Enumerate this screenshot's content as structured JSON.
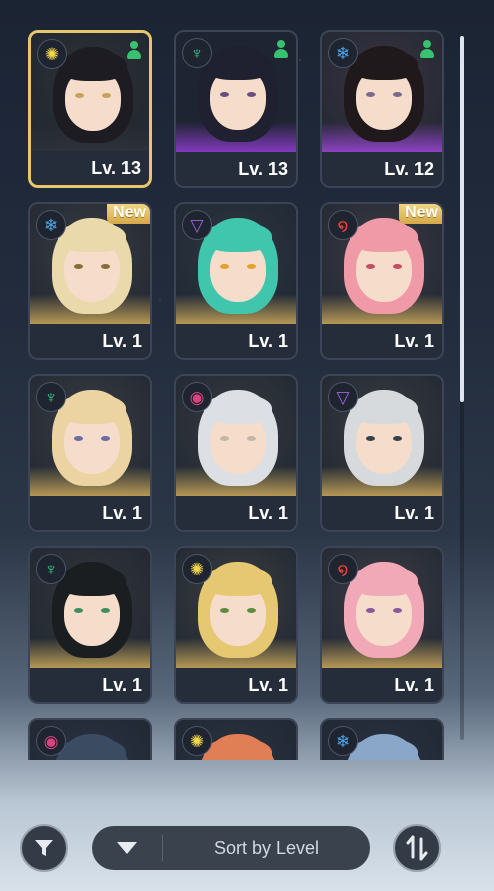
{
  "roster": [
    {
      "level": "Lv. 13",
      "element": "light",
      "role": "support",
      "is_new": false,
      "selected": true,
      "palette": {
        "bg": "#2e3034",
        "hair": "#1c1c22",
        "eye": "#c8a15a",
        "glow": "#30333a"
      }
    },
    {
      "level": "Lv. 13",
      "element": "wind",
      "role": "support",
      "is_new": false,
      "selected": false,
      "palette": {
        "bg": "#1d2233",
        "hair": "#1f2030",
        "eye": "#6a4e7c",
        "glow": "#8f3cd1"
      }
    },
    {
      "level": "Lv. 12",
      "element": "ice",
      "role": "support",
      "is_new": false,
      "selected": false,
      "palette": {
        "bg": "#3a3440",
        "hair": "#20191c",
        "eye": "#7c6a8b",
        "glow": "#9b46d6"
      }
    },
    {
      "level": "Lv. 1",
      "element": "ice",
      "role": "",
      "is_new": true,
      "selected": false,
      "palette": {
        "bg": "#3a3b40",
        "hair": "#ead9aa",
        "eye": "#8a6b3a",
        "glow": "#c9a75a"
      }
    },
    {
      "level": "Lv. 1",
      "element": "void",
      "role": "",
      "is_new": false,
      "selected": false,
      "palette": {
        "bg": "#2c3642",
        "hair": "#3fc6ad",
        "eye": "#e4a22b",
        "glow": "#c9a75a"
      }
    },
    {
      "level": "Lv. 1",
      "element": "fire",
      "role": "",
      "is_new": true,
      "selected": false,
      "palette": {
        "bg": "#3c3b44",
        "hair": "#f09aa8",
        "eye": "#c44c63",
        "glow": "#c9a75a"
      }
    },
    {
      "level": "Lv. 1",
      "element": "wind",
      "role": "",
      "is_new": false,
      "selected": false,
      "palette": {
        "bg": "#3a3c42",
        "hair": "#ecd4a2",
        "eye": "#6b6aa3",
        "glow": "#c9a75a"
      }
    },
    {
      "level": "Lv. 1",
      "element": "psychic",
      "role": "",
      "is_new": false,
      "selected": false,
      "palette": {
        "bg": "#373a40",
        "hair": "#dcdfe3",
        "eye": "#c2b7aa",
        "glow": "#c9a75a"
      }
    },
    {
      "level": "Lv. 1",
      "element": "void",
      "role": "",
      "is_new": false,
      "selected": false,
      "palette": {
        "bg": "#393b40",
        "hair": "#d7dadd",
        "eye": "#3b3f48",
        "glow": "#c9a75a"
      }
    },
    {
      "level": "Lv. 1",
      "element": "wind",
      "role": "",
      "is_new": false,
      "selected": false,
      "palette": {
        "bg": "#33363b",
        "hair": "#1a1e20",
        "eye": "#3f8f5e",
        "glow": "#c9a75a"
      }
    },
    {
      "level": "Lv. 1",
      "element": "light",
      "role": "",
      "is_new": false,
      "selected": false,
      "palette": {
        "bg": "#3b3e40",
        "hair": "#e6c772",
        "eye": "#5e8c3d",
        "glow": "#c9a75a"
      }
    },
    {
      "level": "Lv. 1",
      "element": "fire",
      "role": "",
      "is_new": false,
      "selected": false,
      "palette": {
        "bg": "#3d3d45",
        "hair": "#f1a9b8",
        "eye": "#8a5a9c",
        "glow": "#c9a75a"
      }
    },
    {
      "level": "",
      "element": "psychic",
      "role": "",
      "is_new": false,
      "selected": false,
      "palette": {
        "bg": "#2a3342",
        "hair": "#3a4b62",
        "eye": "#2a3342",
        "glow": "#2a3342"
      }
    },
    {
      "level": "",
      "element": "light",
      "role": "",
      "is_new": false,
      "selected": false,
      "palette": {
        "bg": "#2a3342",
        "hair": "#e07f55",
        "eye": "#2a3342",
        "glow": "#2a3342"
      }
    },
    {
      "level": "",
      "element": "ice",
      "role": "",
      "is_new": false,
      "selected": false,
      "palette": {
        "bg": "#2a3342",
        "hair": "#8aa7c9",
        "eye": "#2a3342",
        "glow": "#2a3342"
      }
    }
  ],
  "new_badge_label": "New",
  "sort": {
    "label": "Sort by Level"
  },
  "element_colors": {
    "light": "#f2d64a",
    "wind": "#3fd18a",
    "ice": "#4aa8f0",
    "void": "#a066e0",
    "fire": "#e5462f",
    "psychic": "#d8437f"
  },
  "element_glyphs": {
    "light": "✺",
    "wind": "♆",
    "ice": "❄",
    "void": "▽",
    "fire": "໑",
    "psychic": "◉"
  },
  "colors": {
    "selected_border": "#e7c66e",
    "role_support": "#37c26f"
  }
}
